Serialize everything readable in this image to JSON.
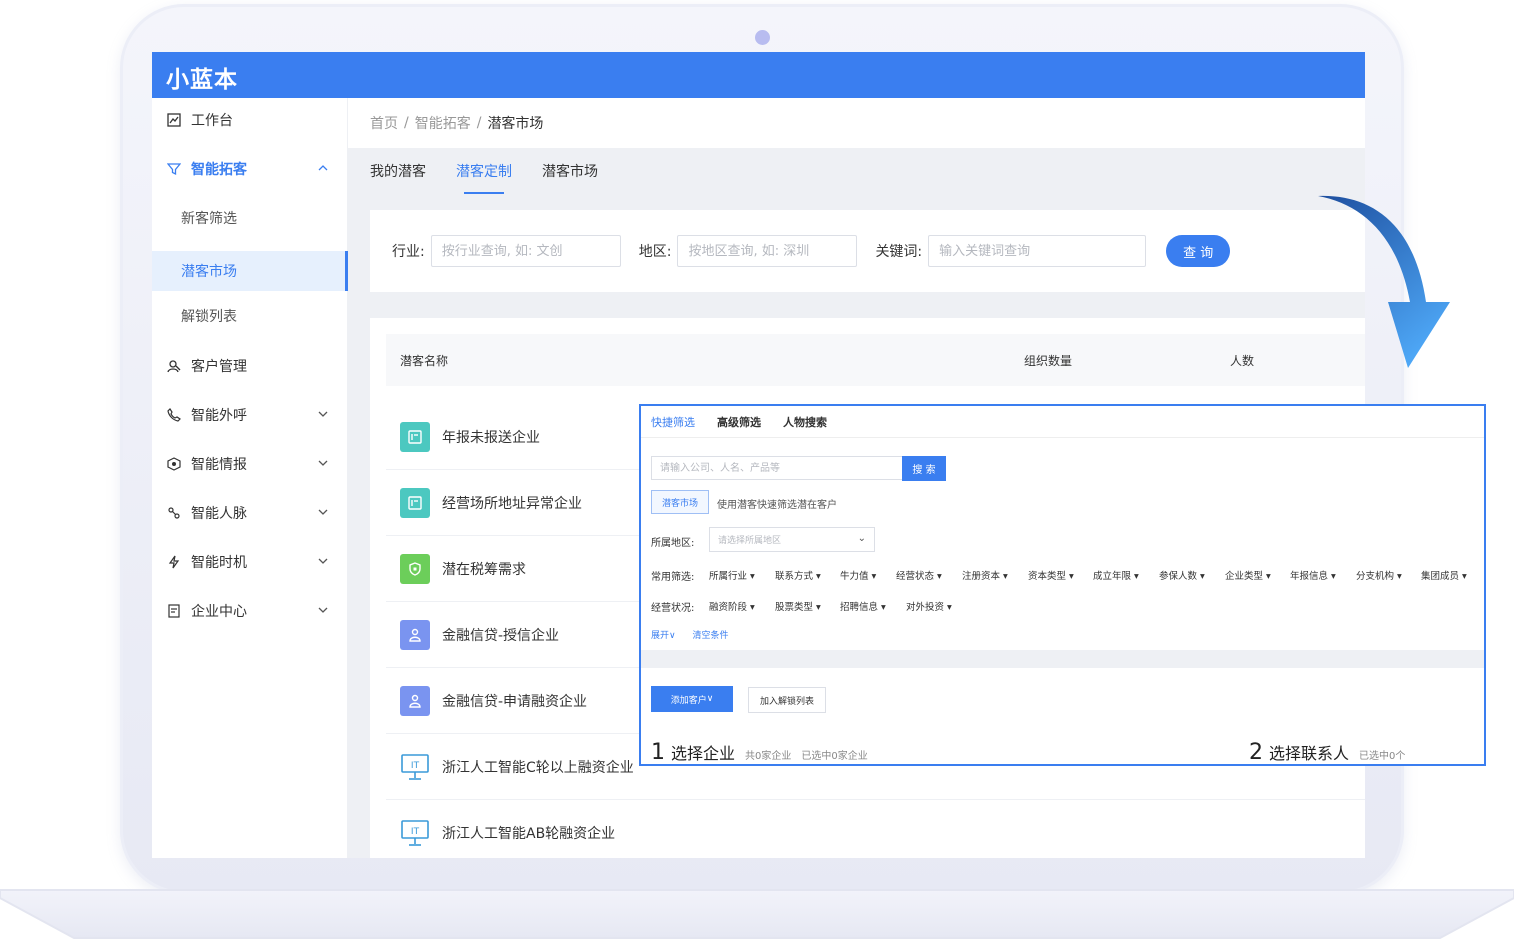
{
  "app": {
    "logo": "小蓝本"
  },
  "sidebar": {
    "items": [
      {
        "label": "工作台",
        "icon": "chart-icon"
      },
      {
        "label": "智能拓客",
        "icon": "filter-icon",
        "expanded": true,
        "children": [
          {
            "label": "新客筛选"
          },
          {
            "label": "潜客市场",
            "active": true
          },
          {
            "label": "解锁列表"
          }
        ]
      },
      {
        "label": "客户管理",
        "icon": "user-search-icon"
      },
      {
        "label": "智能外呼",
        "icon": "phone-icon"
      },
      {
        "label": "智能情报",
        "icon": "intel-icon"
      },
      {
        "label": "智能人脉",
        "icon": "network-icon"
      },
      {
        "label": "智能时机",
        "icon": "lightning-icon"
      },
      {
        "label": "企业中心",
        "icon": "document-icon"
      }
    ]
  },
  "breadcrumb": {
    "items": [
      "首页",
      "智能拓客",
      "潜客市场"
    ]
  },
  "tabs": [
    {
      "label": "我的潜客"
    },
    {
      "label": "潜客定制",
      "active": true
    },
    {
      "label": "潜客市场"
    }
  ],
  "search": {
    "industry_label": "行业:",
    "industry_placeholder": "按行业查询, 如: 文创",
    "region_label": "地区:",
    "region_placeholder": "按地区查询, 如: 深圳",
    "keyword_label": "关键词:",
    "keyword_placeholder": "输入关键词查询",
    "query_button": "查 询"
  },
  "table": {
    "columns": [
      "潜客名称",
      "组织数量",
      "人数"
    ],
    "rows": [
      {
        "name": "年报未报送企业",
        "icon": "report-icon",
        "color": "#4cc8c0"
      },
      {
        "name": "经营场所地址异常企业",
        "icon": "report-icon",
        "color": "#4cc8c0"
      },
      {
        "name": "潜在税筹需求",
        "icon": "shield-icon",
        "color": "#6cce5a"
      },
      {
        "name": "金融信贷-授信企业",
        "icon": "person-icon",
        "color": "#7a94f0"
      },
      {
        "name": "金融信贷-申请融资企业",
        "icon": "person-icon",
        "color": "#7a94f0"
      },
      {
        "name": "浙江人工智能C轮以上融资企业",
        "icon": "it-monitor-icon",
        "color": "#3a9ad9"
      },
      {
        "name": "浙江人工智能AB轮融资企业",
        "icon": "it-monitor-icon",
        "color": "#3a9ad9"
      }
    ]
  },
  "overlay": {
    "tabs": [
      {
        "label": "快捷筛选",
        "active": true
      },
      {
        "label": "高级筛选"
      },
      {
        "label": "人物搜索"
      }
    ],
    "search_placeholder": "请输入公司、人名、产品等",
    "search_button": "搜 索",
    "market_button": "潜客市场",
    "market_hint": "使用潜客快速筛选潜在客户",
    "region_label": "所属地区:",
    "region_placeholder": "请选择所属地区",
    "common_label": "常用筛选:",
    "common_filters": [
      "所属行业",
      "联系方式",
      "牛力值",
      "经营状态",
      "注册资本",
      "资本类型",
      "成立年限",
      "参保人数",
      "企业类型",
      "年报信息",
      "分支机构",
      "集团成员"
    ],
    "status_label": "经营状况:",
    "status_filters": [
      "融资阶段",
      "股票类型",
      "招聘信息",
      "对外投资"
    ],
    "expand_link": "展开",
    "clear_link": "清空条件",
    "add_button": "添加客户",
    "unlock_button": "加入解锁列表",
    "step1": {
      "num": "1",
      "label": "选择企业",
      "total": "共0家企业",
      "selected": "已选中0家企业"
    },
    "step2": {
      "num": "2",
      "label": "选择联系人",
      "selected": "已选中0个"
    }
  },
  "colors": {
    "primary": "#3a7ef0"
  }
}
